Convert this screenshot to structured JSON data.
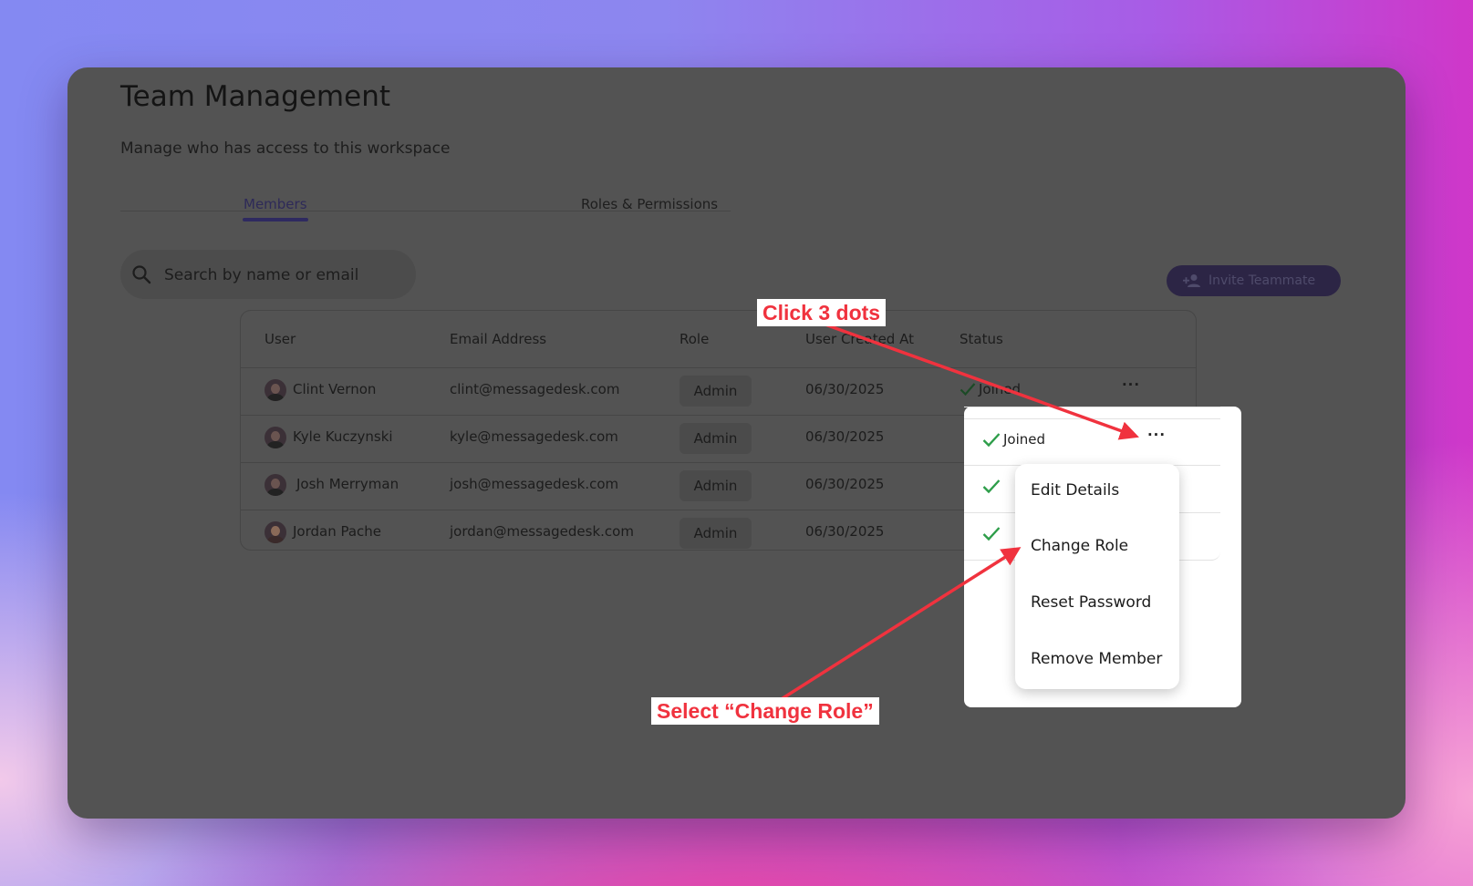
{
  "page": {
    "title": "Team Management",
    "subtitle": "Manage who has access to this workspace"
  },
  "tabs": {
    "members": "Members",
    "roles": "Roles & Permissions"
  },
  "search": {
    "placeholder": "Search by name or email"
  },
  "invite_button": {
    "label": "Invite Teammate"
  },
  "table": {
    "columns": [
      "User",
      "Email Address",
      "Role",
      "User Created At",
      "Status"
    ],
    "rows": [
      {
        "user": "Clint Vernon",
        "email": "clint@messagedesk.com",
        "role": "Admin",
        "created": "06/30/2025",
        "status": "Joined"
      },
      {
        "user": "Kyle Kuczynski",
        "email": "kyle@messagedesk.com",
        "role": "Admin",
        "created": "06/30/2025",
        "status": "Joined"
      },
      {
        "user": "Josh Merryman",
        "email": "josh@messagedesk.com",
        "role": "Admin",
        "created": "06/30/2025",
        "status": "Joined"
      },
      {
        "user": "Jordan Pache",
        "email": "jordan@messagedesk.com",
        "role": "Admin",
        "created": "06/30/2025",
        "status": "Joined"
      }
    ]
  },
  "row_actions_icon": "more-horizontal-icon",
  "status_icon": "check-icon",
  "menu": {
    "items": [
      "Edit Details",
      "Change Role",
      "Reset Password",
      "Remove Member"
    ]
  },
  "annotations": {
    "click_dots": "Click 3 dots",
    "select_change_role": "Select “Change Role”"
  },
  "colors": {
    "accent": "#2c2545",
    "annotation": "#f0323e",
    "check": "#2e9e4a"
  }
}
